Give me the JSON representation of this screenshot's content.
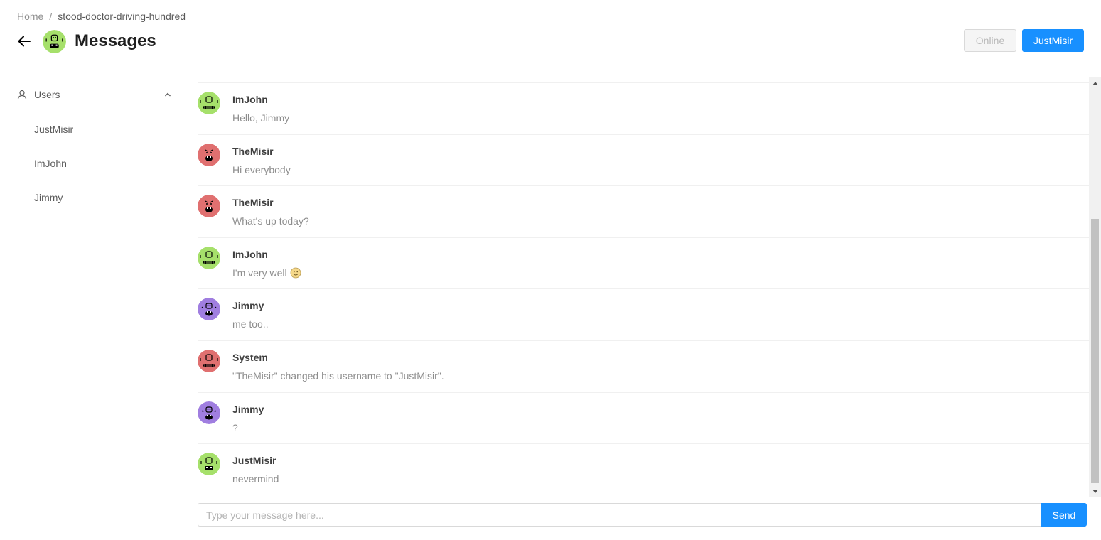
{
  "breadcrumb": {
    "home": "Home",
    "separator": "/",
    "current": "stood-doctor-driving-hundred"
  },
  "header": {
    "title": "Messages",
    "back_icon": "arrow-left-icon",
    "avatar_color": "#a6e06b"
  },
  "actions": {
    "status_label": "Online",
    "user_label": "JustMisir"
  },
  "sidebar": {
    "group_label": "Users",
    "group_icon": "user-icon",
    "expand_icon": "chevron-up-icon",
    "items": [
      {
        "label": "JustMisir"
      },
      {
        "label": "ImJohn"
      },
      {
        "label": "Jimmy"
      }
    ]
  },
  "messages": [
    {
      "author": "ImJohn",
      "text": "Hello, Jimmy",
      "avatar_color": "#a6e06b"
    },
    {
      "author": "TheMisir",
      "text": "Hi everybody",
      "avatar_color": "#e07070"
    },
    {
      "author": "TheMisir",
      "text": "What's up today?",
      "avatar_color": "#e07070"
    },
    {
      "author": "ImJohn",
      "text": "I'm very well",
      "emoji": "smiley-emoji-icon",
      "avatar_color": "#a6e06b"
    },
    {
      "author": "Jimmy",
      "text": "me too..",
      "avatar_color": "#a07ee0"
    },
    {
      "author": "System",
      "text": "\"TheMisir\" changed his username to \"JustMisir\".",
      "avatar_color": "#e07070"
    },
    {
      "author": "Jimmy",
      "text": "?",
      "avatar_color": "#a07ee0"
    },
    {
      "author": "JustMisir",
      "text": "nevermind",
      "avatar_color": "#a6e06b"
    }
  ],
  "composer": {
    "placeholder": "Type your message here...",
    "send_label": "Send"
  },
  "colors": {
    "primary": "#1890ff",
    "border": "#f0f0f0"
  }
}
